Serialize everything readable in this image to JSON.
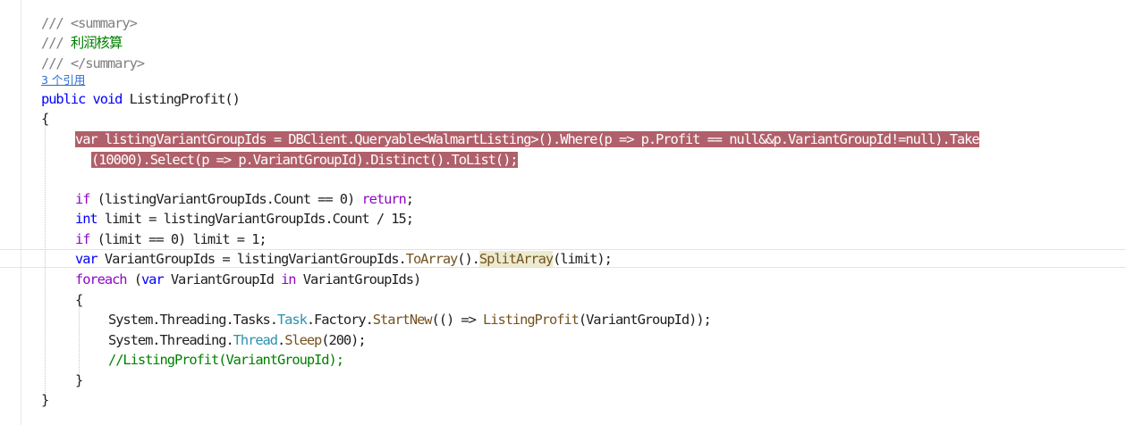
{
  "editor": {
    "colors": {
      "selection": "#b0606a",
      "keyword": "#0000ff",
      "control": "#8f08c4",
      "type": "#2b91af",
      "method": "#74531f",
      "comment": "#008000"
    },
    "lines": [
      [
        {
          "t": "/// <summary>",
          "c": "doc"
        }
      ],
      [
        {
          "t": "/// ",
          "c": "doc"
        },
        {
          "t": "利润核算",
          "c": "cm"
        }
      ],
      [
        {
          "t": "/// </summary>",
          "c": "doc"
        }
      ],
      [
        {
          "t": "3 个引用",
          "c": "ref"
        }
      ],
      [
        {
          "t": "public",
          "c": "kw"
        },
        {
          "t": " ",
          "c": "pn"
        },
        {
          "t": "void",
          "c": "kw"
        },
        {
          "t": " ListingProfit()",
          "c": "pn"
        }
      ],
      [
        {
          "t": "{",
          "c": "pn"
        }
      ],
      [
        {
          "t": "var listingVariantGroupIds = DBClient.Queryable<WalmartListing>().Where(p => p.Profit == null&&p.VariantGroupId!=null).Take",
          "c": "hl"
        }
      ],
      [
        {
          "t": "(10000).Select(p => p.VariantGroupId).Distinct().ToList();",
          "c": "hl"
        }
      ],
      [],
      [
        {
          "t": "if",
          "c": "kw2"
        },
        {
          "t": " (listingVariantGroupIds.Count == 0) ",
          "c": "pn"
        },
        {
          "t": "return",
          "c": "kw2"
        },
        {
          "t": ";",
          "c": "pn"
        }
      ],
      [
        {
          "t": "int",
          "c": "kw"
        },
        {
          "t": " limit = listingVariantGroupIds.Count / 15;",
          "c": "pn"
        }
      ],
      [
        {
          "t": "if",
          "c": "kw2"
        },
        {
          "t": " (limit == 0) limit = 1;",
          "c": "pn"
        }
      ],
      [
        {
          "t": "var",
          "c": "kw"
        },
        {
          "t": " VariantGroupIds = listingVariantGroupIds.",
          "c": "pn"
        },
        {
          "t": "ToArray",
          "c": "mt"
        },
        {
          "t": "().",
          "c": "pn"
        },
        {
          "t": "SplitArray",
          "c": "mt mark"
        },
        {
          "t": "(limit);",
          "c": "pn"
        }
      ],
      [
        {
          "t": "foreach",
          "c": "kw2"
        },
        {
          "t": " (",
          "c": "pn"
        },
        {
          "t": "var",
          "c": "kw"
        },
        {
          "t": " VariantGroupId ",
          "c": "pn"
        },
        {
          "t": "in",
          "c": "kw2"
        },
        {
          "t": " VariantGroupIds)",
          "c": "pn"
        }
      ],
      [
        {
          "t": "{",
          "c": "pn"
        }
      ],
      [
        {
          "t": "System.Threading.Tasks.",
          "c": "pn"
        },
        {
          "t": "Task",
          "c": "ty"
        },
        {
          "t": ".Factory.",
          "c": "pn"
        },
        {
          "t": "StartNew",
          "c": "mt"
        },
        {
          "t": "(() => ",
          "c": "pn"
        },
        {
          "t": "ListingProfit",
          "c": "mt"
        },
        {
          "t": "(VariantGroupId));",
          "c": "pn"
        }
      ],
      [
        {
          "t": "System.Threading.",
          "c": "pn"
        },
        {
          "t": "Thread",
          "c": "ty"
        },
        {
          "t": ".",
          "c": "pn"
        },
        {
          "t": "Sleep",
          "c": "mt"
        },
        {
          "t": "(200);",
          "c": "pn"
        }
      ],
      [
        {
          "t": "//ListingProfit(VariantGroupId);",
          "c": "cm"
        }
      ],
      [
        {
          "t": "}",
          "c": "pn"
        }
      ],
      [
        {
          "t": "}",
          "c": "pn"
        }
      ]
    ]
  }
}
